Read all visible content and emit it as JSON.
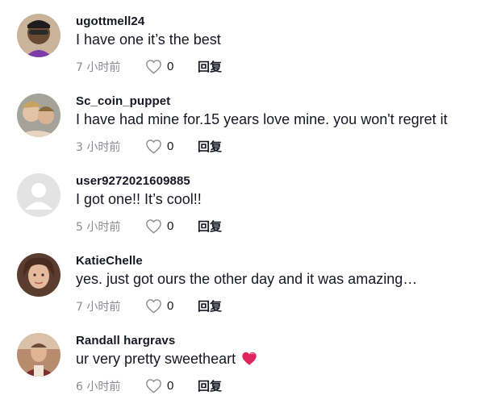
{
  "comments": [
    {
      "username": "ugottmell24",
      "text": "I have one it’s the best",
      "time": "7 小时前",
      "likes": "0",
      "reply": "回复",
      "avatar_color": "#c9a98a"
    },
    {
      "username": "Sc_coin_puppet",
      "text": "I have had mine for.15 years love mine. you won't regret it",
      "time": "3 小时前",
      "likes": "0",
      "reply": "回复",
      "avatar_color": "#9c8f7d"
    },
    {
      "username": "user9272021609885",
      "text": "I got one!! It’s cool!!",
      "time": "5 小时前",
      "likes": "0",
      "reply": "回复",
      "avatar_color": "#e3e3e3"
    },
    {
      "username": "KatieChelle",
      "text": "yes. just got ours the other day and it was amazing…",
      "time": "7 小时前",
      "likes": "0",
      "reply": "回复",
      "avatar_color": "#7a5a48"
    },
    {
      "username": "Randall hargravs",
      "text": "ur very pretty sweetheart",
      "time": "6 小时前",
      "likes": "0",
      "reply": "回复",
      "avatar_color": "#8d6b57",
      "emoji": "heart-emoji"
    }
  ],
  "colors": {
    "text": "#161823",
    "muted": "#8a8b91",
    "heart": "#e0245e"
  }
}
